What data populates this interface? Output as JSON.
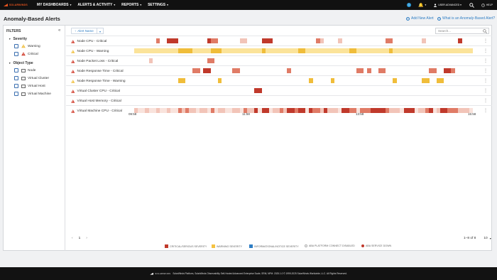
{
  "nav": {
    "brand": "SOLARWINDS",
    "items": [
      "MY DASHBOARDS",
      "ALERTS & ACTIVITY",
      "REPORTS",
      "SETTINGS"
    ],
    "notif_count": "1",
    "user": "USER.ADVANCED",
    "help": "HELP"
  },
  "page": {
    "title": "Anomaly-Based Alerts",
    "add_alert": "Add New Alert",
    "what_is": "What is an Anomaly-Based Alert?"
  },
  "filters": {
    "title": "FILTERS",
    "severity_label": "Severity",
    "severity": [
      "Warning",
      "Critical"
    ],
    "object_type_label": "Object Type",
    "object_types": [
      "Node",
      "Virtual Cluster",
      "Virtual Host",
      "Virtual Machine"
    ]
  },
  "toolbar": {
    "sort_label": "Alert Name",
    "search_placeholder": "Search..."
  },
  "alerts": [
    {
      "name": "Node CPU - Critical",
      "severity": "critical"
    },
    {
      "name": "Node CPU - Warning",
      "severity": "warning"
    },
    {
      "name": "Node Packet Loss - Critical",
      "severity": "critical"
    },
    {
      "name": "Node Response Time - Critical",
      "severity": "critical"
    },
    {
      "name": "Node Response Time - Warning",
      "severity": "warning"
    },
    {
      "name": "Virtual Cluster CPU - Critical",
      "severity": "critical"
    },
    {
      "name": "Virtual Host Memory - Critical",
      "severity": "critical"
    },
    {
      "name": "Virtual Machine CPU - Critical",
      "severity": "critical"
    }
  ],
  "timeline": {
    "ticks": [
      "09:58",
      "11:58",
      "13:58",
      "15:58"
    ]
  },
  "pagination": {
    "prev": "‹",
    "page": "1",
    "next": "›",
    "range": "1–8 of 8",
    "page_size": "10"
  },
  "legend": [
    {
      "label": "CRITICAL/SERIOUS SEVERITY",
      "color": "#c0392b"
    },
    {
      "label": "WARNING SEVERITY",
      "color": "#f5c242"
    },
    {
      "label": "INFORMATIONAL/NOTICE SEVERITY",
      "color": "#2f7ec4"
    },
    {
      "label": "ABA PLATFORM CONNECT DISABLED",
      "color": "#cccccc"
    },
    {
      "label": "ABA SERVICE DOWN",
      "color": "#c0392b"
    }
  ],
  "footer": {
    "brand": "SOLARWINDS",
    "text": "SolarWinds Platform, SolarWinds Observability Self-Hosted Advanced Enterprise Scale, SRM, NPM: 2025.1.0 © 1999-2025 SolarWinds Worldwide, LLC. All Rights Reserved."
  },
  "colors": {
    "critical_dark": "#c0392b",
    "critical_mid": "#e07b66",
    "critical_light": "#f2c4b8",
    "critical_pale": "#f9e3dc",
    "warning_dark": "#f0bd3a",
    "warning_light": "#fbe39a",
    "warning_pale": "#fdf1c8",
    "accent": "#2f7ec4"
  }
}
